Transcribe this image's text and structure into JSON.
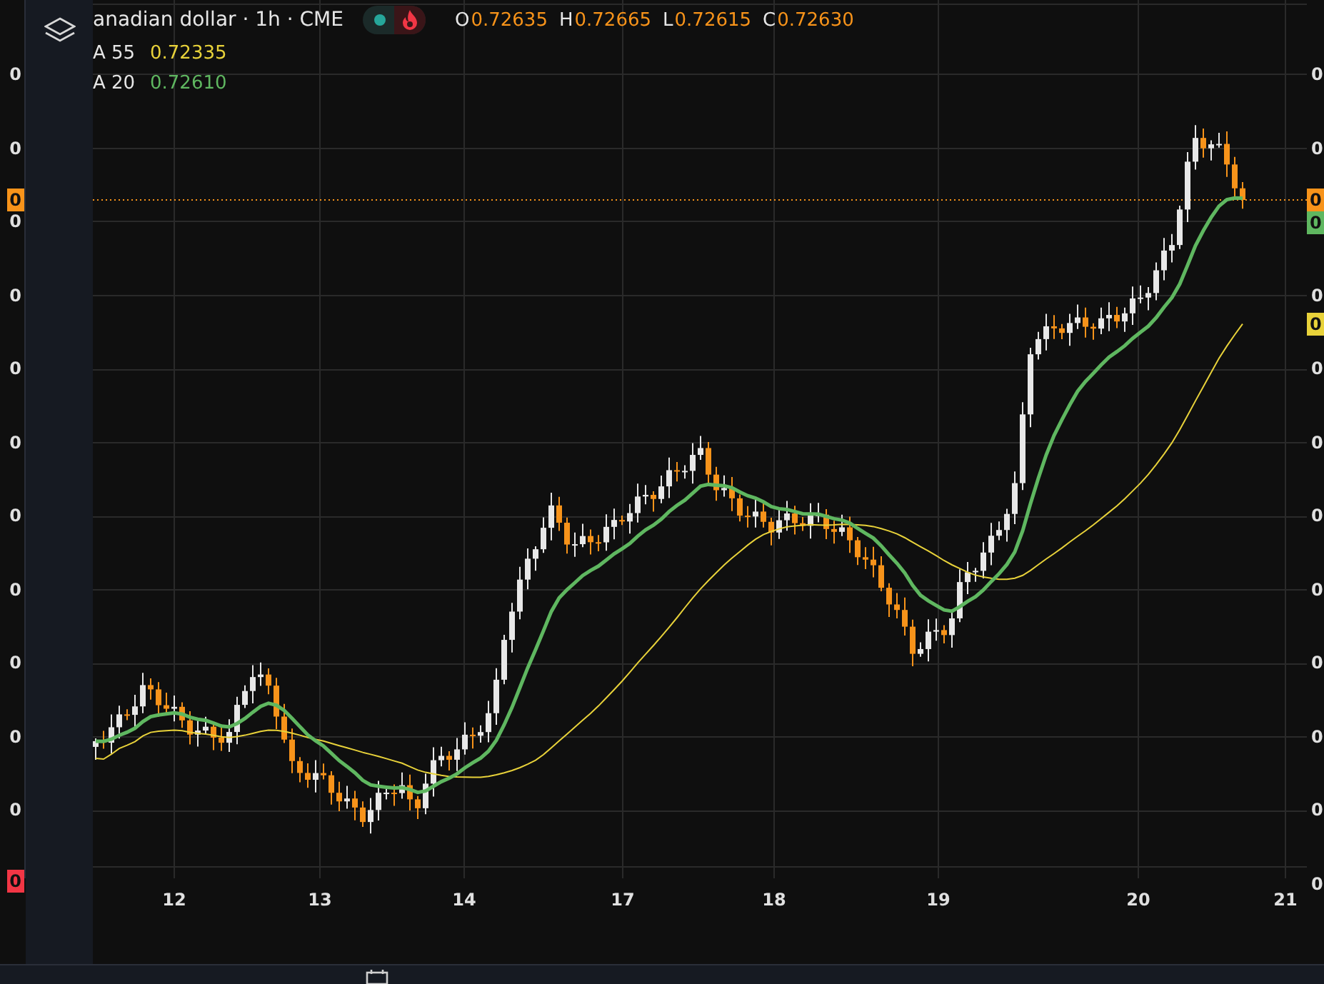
{
  "legend": {
    "symbol": "anadian dollar · 1h · CME",
    "ohlc": [
      {
        "label": "O",
        "value": "0.72635"
      },
      {
        "label": "H",
        "value": "0.72665"
      },
      {
        "label": "L",
        "value": "0.72615"
      },
      {
        "label": "C",
        "value": "0.72630"
      }
    ],
    "indicators": [
      {
        "label": "A 55",
        "value": "0.72335",
        "color": "#e8d23a"
      },
      {
        "label": "A 20",
        "value": "0.72610",
        "color": "#5fb760"
      }
    ]
  },
  "left_axis": {
    "labels": [
      "0",
      "0",
      "0",
      "0",
      "0",
      "0",
      "0",
      "0",
      "0",
      "0",
      "0"
    ],
    "tags": [
      {
        "kind": "price",
        "text": "0",
        "color": "#f7931a"
      },
      {
        "kind": "alert",
        "text": "0",
        "color": "#f23645"
      }
    ]
  },
  "right_axis": {
    "labels": [
      "0",
      "0",
      "0",
      "0",
      "0",
      "0",
      "0",
      "0",
      "0",
      "0",
      "0"
    ],
    "tags": [
      {
        "kind": "price",
        "text": "0",
        "color": "#f7931a"
      },
      {
        "kind": "fast_average",
        "text": "0",
        "color": "#5fb760"
      },
      {
        "kind": "slow_average",
        "text": "0",
        "color": "#e8d23a"
      }
    ]
  },
  "time_axis": {
    "labels": [
      "12",
      "13",
      "14",
      "17",
      "18",
      "19",
      "20",
      "21"
    ]
  }
}
